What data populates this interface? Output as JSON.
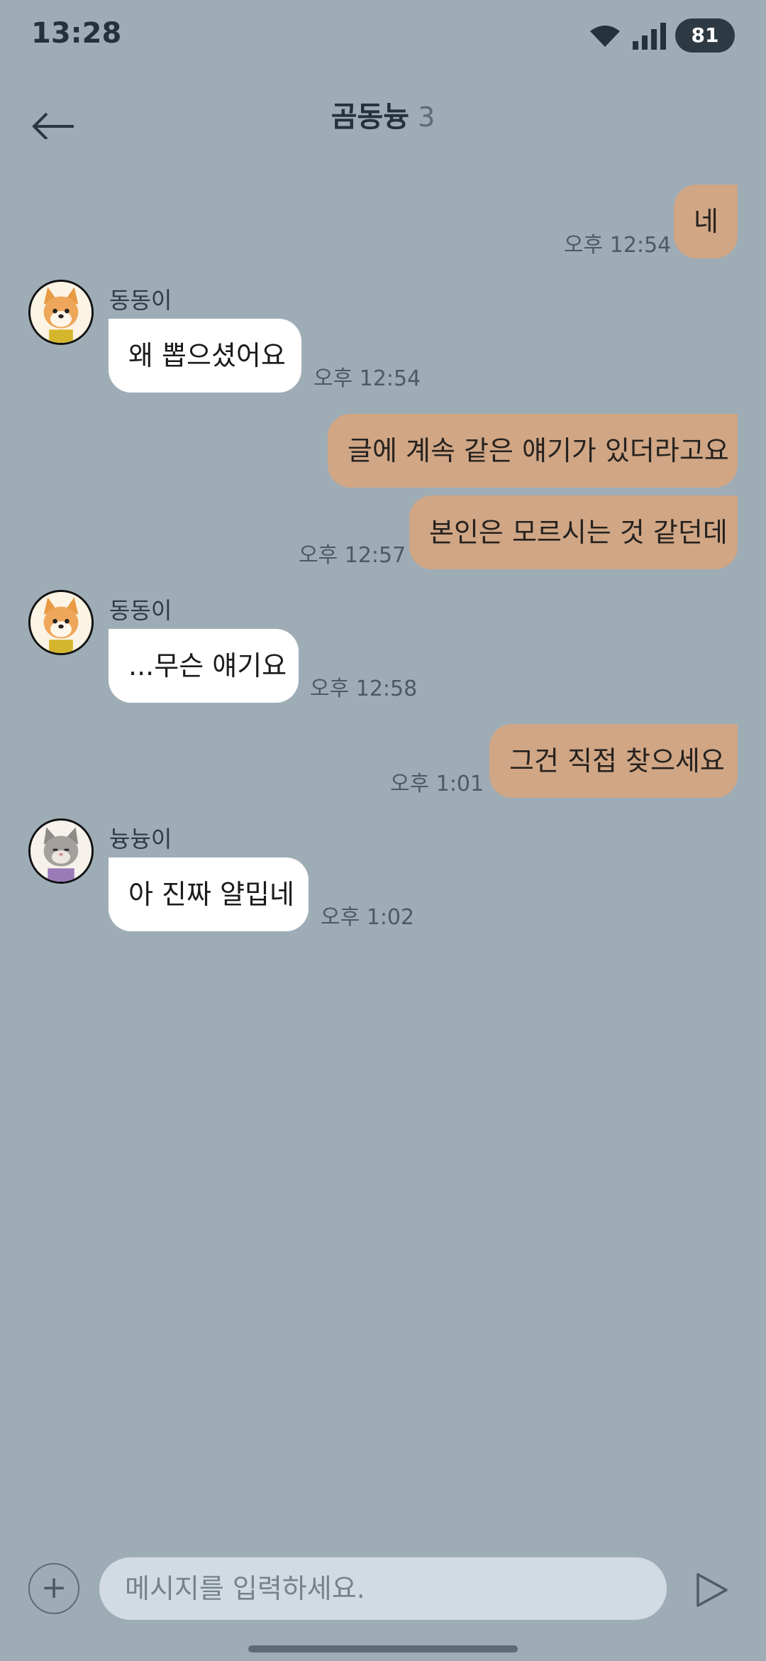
{
  "status_bar": {
    "time": "13:28",
    "battery": "81",
    "icons": [
      "wifi-icon",
      "signal-icon"
    ]
  },
  "header": {
    "back_icon": "arrow-left-icon",
    "title": "곰동늉",
    "member_count": "3"
  },
  "messages": [
    {
      "side": "out",
      "text": "네",
      "time": "오후 12:54"
    },
    {
      "side": "in",
      "sender": "동동이",
      "avatar": "dog-avatar",
      "text": "왜 뽑으셨어요",
      "time": "오후 12:54"
    },
    {
      "side": "out",
      "text": "글에 계속 같은 얘기가 있더라고요",
      "time": ""
    },
    {
      "side": "out",
      "text": "본인은 모르시는 것 같던데",
      "time": "오후 12:57"
    },
    {
      "side": "in",
      "sender": "동동이",
      "avatar": "dog-avatar",
      "text": "...무슨 얘기요",
      "time": "오후 12:58"
    },
    {
      "side": "out",
      "text": "그건 직접 찾으세요",
      "time": "오후 1:01"
    },
    {
      "side": "in",
      "sender": "늉늉이",
      "avatar": "cat-avatar",
      "text": "아 진짜 얄밉네",
      "time": "오후 1:02"
    }
  ],
  "composer": {
    "placeholder": "메시지를 입력하세요.",
    "add_icon": "plus-icon",
    "send_icon": "send-icon"
  },
  "colors": {
    "background": "#9eacb6",
    "outgoing_bubble": "#d0a685",
    "incoming_bubble": "#ffffff"
  }
}
